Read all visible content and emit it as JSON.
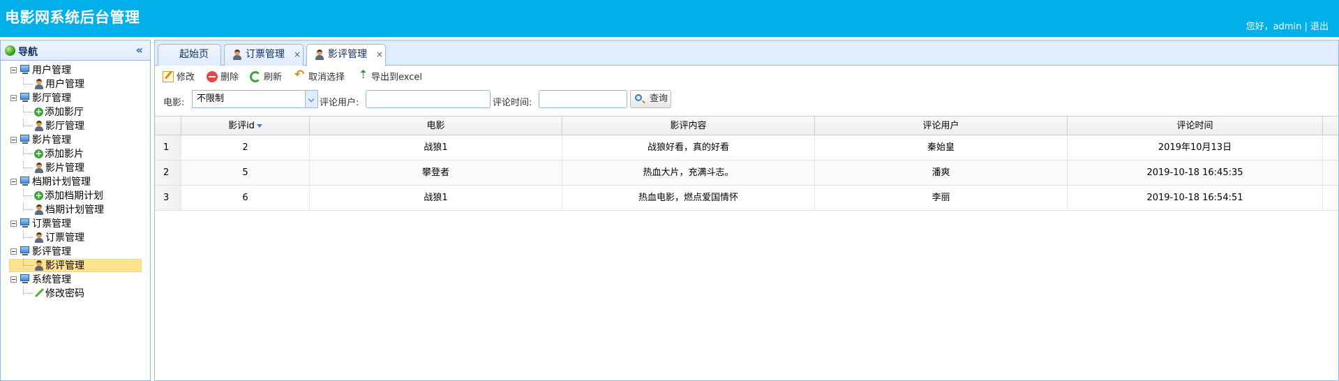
{
  "header": {
    "title": "电影网系统后台管理",
    "greeting": "您好，",
    "username": "admin",
    "separator": "|",
    "logout": "退出"
  },
  "sidebar": {
    "title": "导航",
    "collapse_glyph": "«",
    "groups": [
      {
        "label": "用户管理",
        "children": [
          {
            "label": "用户管理",
            "icon": "user-icon"
          }
        ]
      },
      {
        "label": "影厅管理",
        "children": [
          {
            "label": "添加影厅",
            "icon": "add-icon"
          },
          {
            "label": "影厅管理",
            "icon": "user-icon"
          }
        ]
      },
      {
        "label": "影片管理",
        "children": [
          {
            "label": "添加影片",
            "icon": "add-icon"
          },
          {
            "label": "影片管理",
            "icon": "user-icon"
          }
        ]
      },
      {
        "label": "档期计划管理",
        "children": [
          {
            "label": "添加档期计划",
            "icon": "add-icon"
          },
          {
            "label": "档期计划管理",
            "icon": "user-icon"
          }
        ]
      },
      {
        "label": "订票管理",
        "children": [
          {
            "label": "订票管理",
            "icon": "user-icon"
          }
        ]
      },
      {
        "label": "影评管理",
        "children": [
          {
            "label": "影评管理",
            "icon": "user-icon",
            "selected": true
          }
        ]
      },
      {
        "label": "系统管理",
        "children": [
          {
            "label": "修改密码",
            "icon": "pencil-icon"
          }
        ]
      }
    ]
  },
  "tabs": [
    {
      "label": "起始页",
      "closable": false,
      "active": false
    },
    {
      "label": "订票管理",
      "closable": true,
      "active": false
    },
    {
      "label": "影评管理",
      "closable": true,
      "active": true
    }
  ],
  "toolbar": {
    "edit": "修改",
    "delete": "删除",
    "refresh": "刷新",
    "cancel_select": "取消选择",
    "export": "导出到excel"
  },
  "search": {
    "movie_label": "电影:",
    "movie_value": "不限制",
    "user_label": "评论用户:",
    "user_value": "",
    "time_label": "评论时间:",
    "time_value": "",
    "query_button": "查询"
  },
  "grid": {
    "columns": [
      "影评id",
      "电影",
      "影评内容",
      "评论用户",
      "评论时间"
    ],
    "rows": [
      {
        "num": "1",
        "id": "2",
        "movie": "战狼1",
        "content": "战狼好看，真的好看",
        "user": "秦始皇",
        "time": "2019年10月13日"
      },
      {
        "num": "2",
        "id": "5",
        "movie": "攀登者",
        "content": "热血大片，充满斗志。",
        "user": "潘爽",
        "time": "2019-10-18 16:45:35"
      },
      {
        "num": "3",
        "id": "6",
        "movie": "战狼1",
        "content": "热血电影，燃点爱国情怀",
        "user": "李丽",
        "time": "2019-10-18 16:54:51"
      }
    ]
  },
  "colors": {
    "header_bg": "#01b0ea",
    "panel_border": "#95b8e7",
    "selected_bg": "#ffe48d"
  }
}
